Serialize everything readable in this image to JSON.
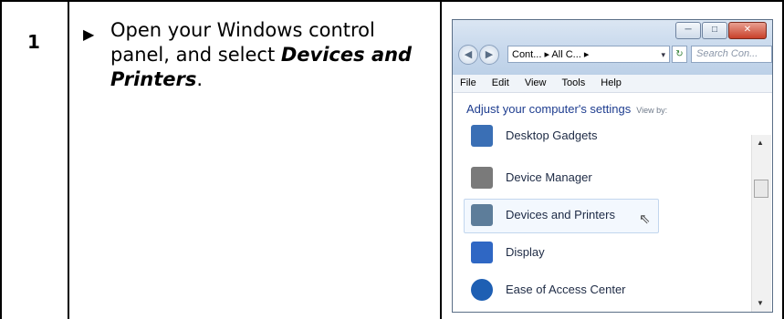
{
  "step": {
    "number": "1",
    "bullet": "▶",
    "text_before": "Open your Windows control panel, and select ",
    "text_emphasis": "Devices and Printers",
    "text_after": "."
  },
  "window": {
    "controls": {
      "minimize": "─",
      "maximize": "□",
      "close": "✕"
    },
    "nav": {
      "back": "◀",
      "forward": "▶"
    },
    "address": "Cont... ▸ All C... ▸",
    "address_dropdown": "▾",
    "refresh": "↻",
    "search_placeholder": "Search Con...",
    "menus": [
      "File",
      "Edit",
      "View",
      "Tools",
      "Help"
    ],
    "heading": "Adjust your computer's settings",
    "view_by": "View by:",
    "items": [
      {
        "label": "Desktop Gadgets",
        "icon": "gadgets-icon",
        "color": "#3a6fb5"
      },
      {
        "label": "Device Manager",
        "icon": "device-manager-icon",
        "color": "#7a7a7a"
      },
      {
        "label": "Devices and Printers",
        "icon": "printer-icon",
        "color": "#5d7d9a"
      },
      {
        "label": "Display",
        "icon": "display-icon",
        "color": "#2f67c4"
      },
      {
        "label": "Ease of Access Center",
        "icon": "ease-of-access-icon",
        "color": "#1e5fb3"
      }
    ],
    "highlighted_item": "Devices and Printers"
  }
}
